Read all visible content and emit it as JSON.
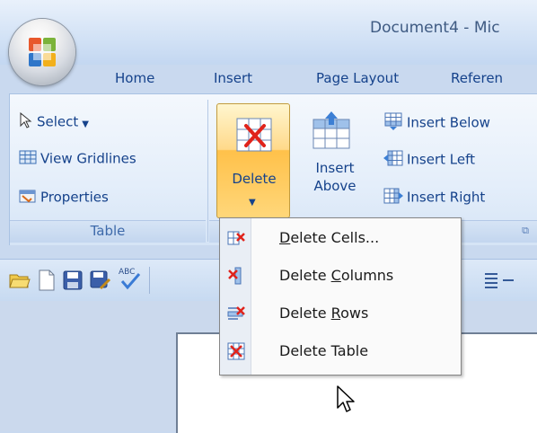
{
  "window": {
    "title": "Document4 - Mic"
  },
  "tabs": [
    "Home",
    "Insert",
    "Page Layout",
    "Referen"
  ],
  "table_group": {
    "select_label": "Select",
    "view_gridlines_label": "View Gridlines",
    "properties_label": "Properties",
    "footer": "Table"
  },
  "rows_columns_group": {
    "delete_label": "Delete",
    "insert_above_line1": "Insert",
    "insert_above_line2": "Above",
    "insert_below_label": "Insert Below",
    "insert_left_label": "Insert Left",
    "insert_right_label": "Insert Right"
  },
  "delete_menu": {
    "items": [
      {
        "label": "Delete Cells...",
        "underline": "D"
      },
      {
        "label": "Delete Columns",
        "underline": "C"
      },
      {
        "label": "Delete Rows",
        "underline": "R"
      },
      {
        "label": "Delete Table",
        "underline": "t"
      }
    ]
  },
  "colors": {
    "accent_text": "#15428b",
    "delete_highlight": "#ffc14a",
    "ribbon_bg": "#e4eefa"
  }
}
